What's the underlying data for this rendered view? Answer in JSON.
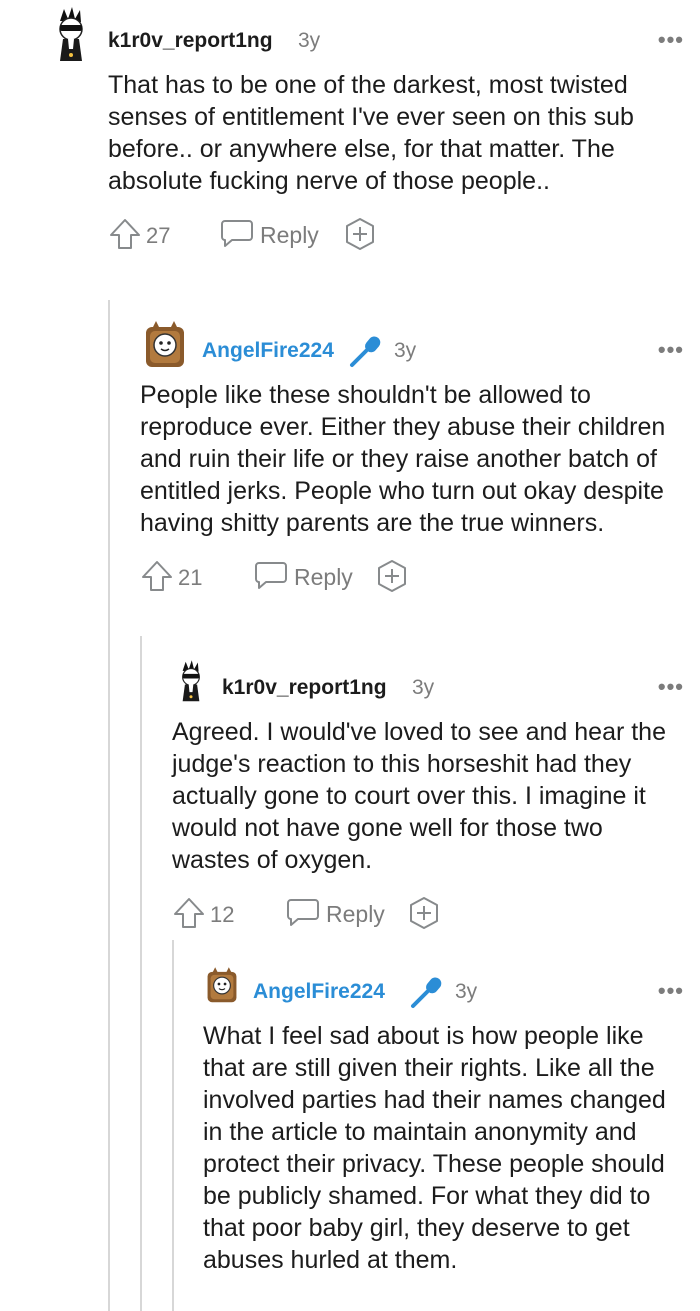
{
  "comments": [
    {
      "username": "k1r0v_report1ng",
      "time": "3y",
      "more": "•••",
      "body": "That has to be one of the darkest, most twisted senses of entitlement I've ever seen on this sub before.. or anywhere else, for that matter. The absolute fucking nerve of those people..",
      "votes": "27",
      "reply_label": "Reply"
    },
    {
      "username": "AngelFire224",
      "time": "3y",
      "more": "•••",
      "body": "People like these shouldn't be allowed to reproduce ever. Either they abuse their children and ruin their life or they raise another batch of entitled jerks. People who turn out okay despite having shitty parents are the true winners.",
      "votes": "21",
      "reply_label": "Reply"
    },
    {
      "username": "k1r0v_report1ng",
      "time": "3y",
      "more": "•••",
      "body": "Agreed. I would've loved to see and hear the judge's reaction to this horseshit had they actually gone to court over this. I imagine it would not have gone well for those two wastes of oxygen.",
      "votes": "12",
      "reply_label": "Reply"
    },
    {
      "username": "AngelFire224",
      "time": "3y",
      "more": "•••",
      "body": "What I feel sad about is how people like that are still given their rights. Like all the involved parties had their names changed in the article to maintain anonymity and protect their privacy. These people should be publicly shamed. For what they did to that poor baby girl, they deserve to get abuses hurled at them."
    }
  ],
  "colors": {
    "op_username": "#2b8dd6",
    "meta": "#7c7c7c",
    "thread_line": "#d7d7d7"
  },
  "icons": {
    "flair": "microphone-icon",
    "upvote": "upvote-arrow-icon",
    "reply": "chat-bubble-icon",
    "award": "award-plus-icon"
  }
}
